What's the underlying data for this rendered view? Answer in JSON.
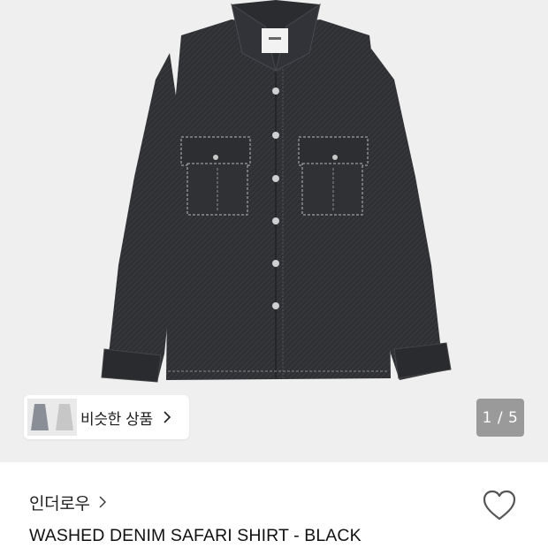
{
  "gallery": {
    "image_alt": "Washed denim safari shirt in black",
    "similar_label": "비슷한 상품",
    "counter": "1 / 5",
    "current_page": 1,
    "total_pages": 5
  },
  "product": {
    "brand": "인더로우",
    "title": "WASHED DENIM SAFARI SHIRT - BLACK"
  },
  "icons": {
    "similar_chevron": "chevron-right-icon",
    "brand_chevron": "chevron-right-icon",
    "wishlist": "heart-outline-icon"
  },
  "colors": {
    "gallery_bg": "#efefef",
    "shirt": "#2e2f33",
    "stitch": "#bdbdbd",
    "counter_bg": "#7b7b7b"
  }
}
